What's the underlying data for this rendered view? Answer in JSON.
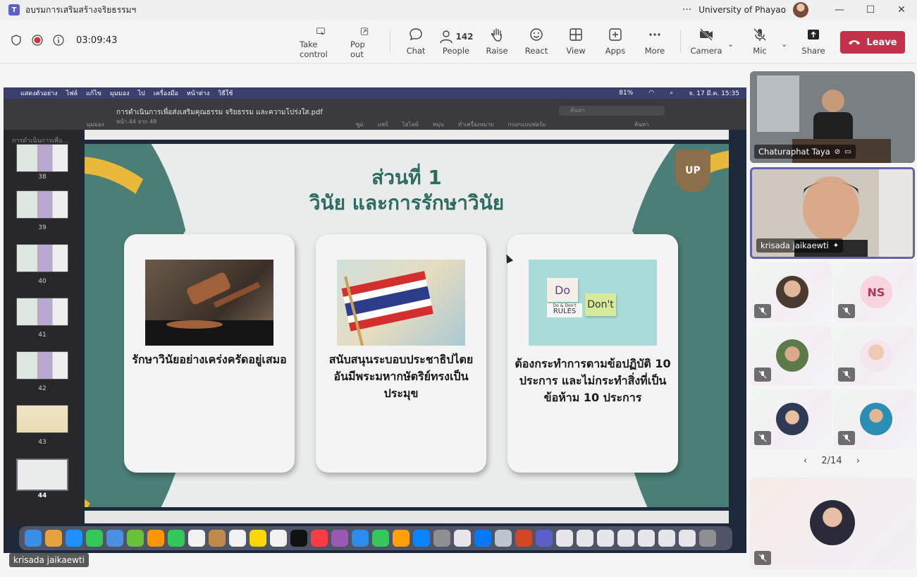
{
  "window": {
    "title": "อบรมการเสริมสร้างจริยธรรมฯ",
    "org": "University of Phayao",
    "more_dots": "···",
    "minimize": "—",
    "maximize": "☐",
    "close": "✕"
  },
  "meeting": {
    "timer": "03:09:43",
    "toolbar": {
      "take_control": "Take control",
      "pop_out": "Pop out",
      "chat": "Chat",
      "people": "People",
      "people_count": "142",
      "raise": "Raise",
      "react": "React",
      "view": "View",
      "apps": "Apps",
      "more": "More",
      "camera": "Camera",
      "mic": "Mic",
      "share": "Share",
      "leave": "Leave"
    },
    "pager": "2/14",
    "presenter_label": "krisada jaikaewti"
  },
  "mac": {
    "menu": [
      "แสดงตัวอย่าง",
      "ไฟล์",
      "แก้ไข",
      "มุมมอง",
      "ไป",
      "เครื่องมือ",
      "หน้าต่าง",
      "วิธีใช้"
    ],
    "battery": "81%",
    "clock": "จ. 17 มี.ค. 15:35"
  },
  "pdf": {
    "filename": "การดำเนินการเพื่อส่งเสริมคุณธรรม จริยธรรม และความโปร่งใส.pdf",
    "page_info": "หน้า 44 จาก 48",
    "search_placeholder": "ค้นหา",
    "toolbar_labels": [
      "มุมมอง",
      "ซูม",
      "แชร์",
      "ไฮไลท์",
      "หมุน",
      "ทำเครื่องหมาย",
      "กรอกแบบฟอร์ม",
      "ค้นหา"
    ],
    "sidebar_heading": "การดำเนินการเพื่อ...",
    "thumbnails": [
      "38",
      "39",
      "40",
      "41",
      "42",
      "43",
      "44"
    ],
    "selected_page": "44"
  },
  "slide": {
    "title_line1": "ส่วนที่ 1",
    "title_line2": "วินัย และการรักษาวินัย",
    "logo_text": "UP",
    "cards": [
      {
        "text": "รักษาวินัยอย่างเคร่งครัดอยู่เสมอ",
        "image": "gavel-image"
      },
      {
        "text": "สนับสนุนระบอบประชาธิปไตยอันมีพระมหากษัตริย์ทรงเป็นประมุข",
        "image": "thai-flag-image"
      },
      {
        "text": "ต้องกระทำการตามข้อปฏิบัติ 10 ประการ และไม่กระทำสิ่งที่เป็นข้อห้าม 10 ประการ",
        "image": "do-dont-rules-image"
      }
    ],
    "do_label": "Do",
    "dont_label": "Don't",
    "rules_label": "RULES",
    "rules_small": "Do & Don't"
  },
  "participants": {
    "video": [
      {
        "name": "Chaturaphat Taya"
      },
      {
        "name": "krisada jaikaewti"
      }
    ],
    "ns_initials": "NS"
  },
  "colors": {
    "leave": "#c4314b",
    "teams_accent": "#5b5fc7",
    "slide_green": "#2e6b62",
    "slide_gold": "#e8b93b"
  }
}
